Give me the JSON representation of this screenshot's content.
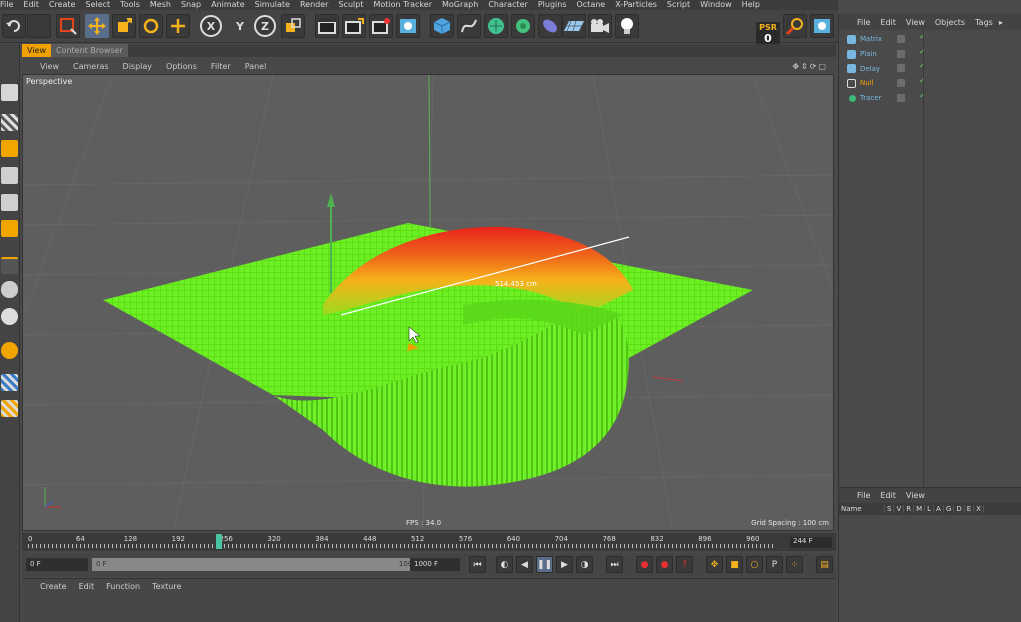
{
  "menubar": {
    "items": [
      "File",
      "Edit",
      "Create",
      "Select",
      "Tools",
      "Mesh",
      "Snap",
      "Animate",
      "Simulate",
      "Render",
      "Sculpt",
      "Motion Tracker",
      "MoGraph",
      "Character",
      "Plugins",
      "Octane",
      "X-Particles",
      "Script",
      "Window",
      "Help"
    ]
  },
  "toolbar": {
    "x_axis": "X",
    "y_axis": "Y",
    "z_axis": "Z",
    "psr_label": "PSR",
    "psr_value": "0"
  },
  "viewport": {
    "tabs": [
      "View",
      "Content Browser"
    ],
    "menu": [
      "View",
      "Cameras",
      "Display",
      "Options",
      "Filter",
      "Panel"
    ],
    "camera": "Perspective",
    "fps": "FPS : 34.0",
    "grid_spacing": "Grid Spacing : 100 cm",
    "measure": "514.453 cm",
    "colors": {
      "low": "#66ee1e",
      "mid": "#f7b11a",
      "high": "#e8231c",
      "background": "#5e5e5e"
    }
  },
  "timeline": {
    "ticks": [
      "0",
      "64",
      "128",
      "192",
      "256",
      "320",
      "384",
      "448",
      "512",
      "576",
      "640",
      "704",
      "768",
      "832",
      "896",
      "960"
    ],
    "current_frame": 256,
    "max_frame": 1000,
    "end_frame_display": "244 F"
  },
  "playback": {
    "start_field": "0 F",
    "range_start": "0 F",
    "range_end": "1000 F",
    "end_field": "1000 F"
  },
  "material_bar": {
    "menu": [
      "Create",
      "Edit",
      "Function",
      "Texture"
    ]
  },
  "object_manager": {
    "menu": [
      "File",
      "Edit",
      "View",
      "Objects",
      "Tags"
    ],
    "objects": [
      {
        "name": "Matrix",
        "icon": "matrix-icon",
        "color": "#79b8e0"
      },
      {
        "name": "Plain",
        "icon": "plain-effector-icon",
        "color": "#79b8e0"
      },
      {
        "name": "Delay",
        "icon": "delay-effector-icon",
        "color": "#79b8e0"
      },
      {
        "name": "Null",
        "icon": "null-object-icon",
        "color": "#f0a000"
      },
      {
        "name": "Tracer",
        "icon": "tracer-icon",
        "color": "#79b8e0"
      }
    ]
  },
  "attribute_manager": {
    "menu": [
      "File",
      "Edit",
      "View"
    ],
    "columns": [
      "Name",
      "S",
      "V",
      "R",
      "M",
      "L",
      "A",
      "G",
      "D",
      "E",
      "X"
    ]
  }
}
